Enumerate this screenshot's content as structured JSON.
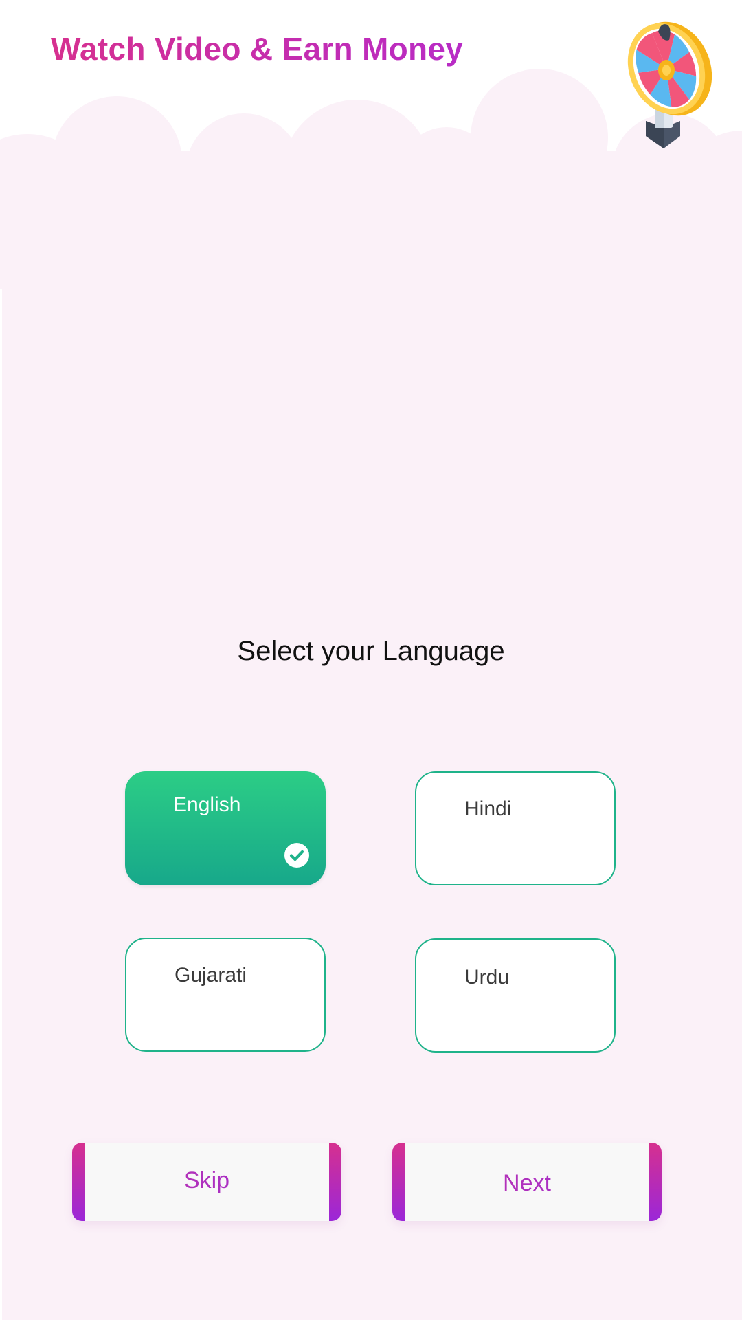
{
  "header": {
    "app_title": "Watch Video & Earn Money"
  },
  "language_screen": {
    "title": "Select your Language",
    "selected": "English",
    "options": [
      {
        "label": "English",
        "selected": true
      },
      {
        "label": "Hindi",
        "selected": false
      },
      {
        "label": "Gujarati",
        "selected": false
      },
      {
        "label": "Urdu",
        "selected": false
      }
    ]
  },
  "actions": {
    "skip_label": "Skip",
    "next_label": "Next"
  },
  "icons": {
    "wheel": "spin-wheel-icon",
    "check": "check-circle-icon"
  },
  "colors": {
    "brand_pink": "#d6308f",
    "brand_purple": "#9b27d8",
    "selected_green": "#1fb38a",
    "background_pink": "#fbf1f8"
  }
}
